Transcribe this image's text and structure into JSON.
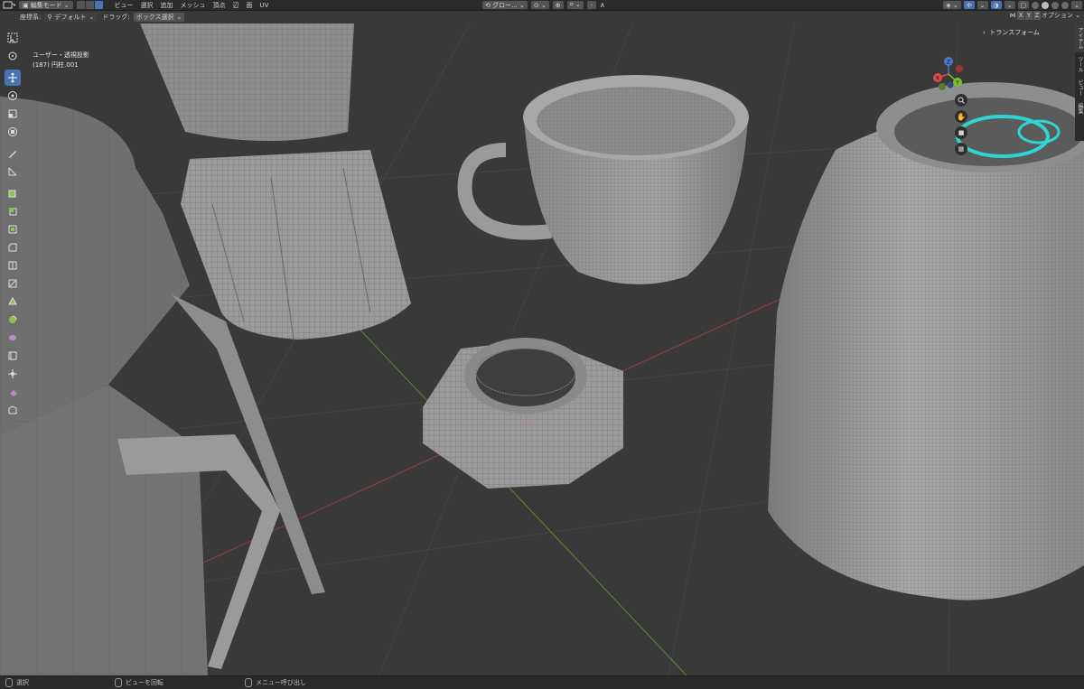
{
  "header": {
    "mode_label": "編集モード",
    "menus": [
      "ビュー",
      "選択",
      "追加",
      "メッシュ",
      "頂点",
      "辺",
      "面",
      "UV"
    ],
    "transform_orientation": "グロー...",
    "right_icons": [
      "pivot-icon",
      "snap-icon",
      "proportional-icon",
      "falloff-icon"
    ]
  },
  "tool_header": {
    "orientation_label": "座標系:",
    "orientation_value": "デフォルト",
    "drag_label": "ドラッグ:",
    "drag_value": "ボックス選択",
    "axes": [
      "X",
      "Y",
      "Z"
    ],
    "options_label": "オプション"
  },
  "viewport": {
    "view_name": "ユーザー・透視投影",
    "object_info": "(187) 円柱.001"
  },
  "toolbar": {
    "tools": [
      "select-box-icon",
      "cursor-icon",
      "move-icon",
      "rotate-icon",
      "scale-icon",
      "transform-icon",
      "annotate-icon",
      "measure-icon",
      "add-cube-icon",
      "extrude-icon",
      "inset-icon",
      "bevel-icon",
      "loop-cut-icon",
      "knife-icon",
      "poly-build-icon",
      "spin-icon",
      "smooth-icon",
      "edge-slide-icon",
      "shrink-fatten-icon",
      "shear-icon",
      "rip-icon"
    ],
    "active_index": 2
  },
  "gizmo": {
    "axis_labels": [
      "Z",
      "X",
      "Y"
    ],
    "buttons": [
      "zoom-icon",
      "pan-hand-icon",
      "camera-icon",
      "grid-icon"
    ]
  },
  "side_panel": {
    "section": "トランスフォーム",
    "tabs": [
      "アイテム",
      "ツール",
      "ビュー",
      "編集"
    ]
  },
  "status_bar": {
    "items": [
      "選択",
      "ビューを回転",
      "メニュー呼び出し"
    ]
  },
  "colors": {
    "accent": "#4772b3",
    "background": "#393939",
    "header": "#2b2b2b",
    "selection": "#2fd4d4",
    "x_axis": "#9a3d3d",
    "y_axis": "#5d8a2a"
  }
}
